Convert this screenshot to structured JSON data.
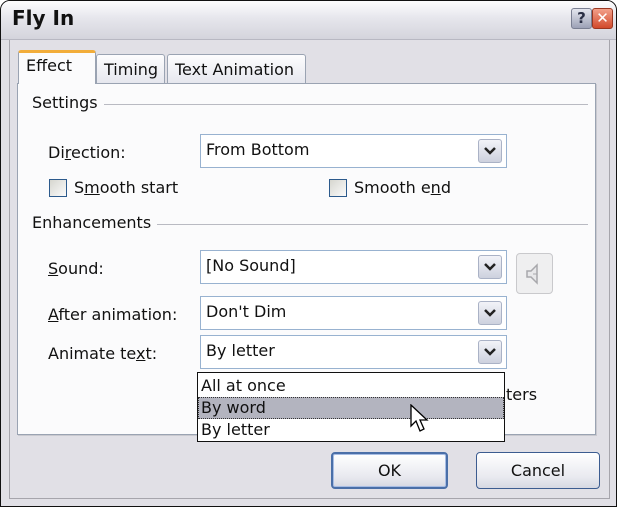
{
  "window": {
    "title": "Fly In",
    "help_icon": "help-icon",
    "close_icon": "close-icon",
    "help_glyph": "?",
    "close_glyph": "✕"
  },
  "tabs": [
    {
      "label": "Effect",
      "active": true
    },
    {
      "label": "Timing",
      "active": false
    },
    {
      "label": "Text Animation",
      "active": false
    }
  ],
  "settings": {
    "group_label": "Settings",
    "direction": {
      "label_pre": "Di",
      "label_u": "r",
      "label_post": "ection:",
      "value": "From Bottom"
    },
    "smooth_start": {
      "label_pre": "S",
      "label_u": "m",
      "label_post": "ooth start",
      "checked": false
    },
    "smooth_end": {
      "label_pre": "Smooth e",
      "label_u": "n",
      "label_post": "d",
      "checked": false
    }
  },
  "enhancements": {
    "group_label": "Enhancements",
    "sound": {
      "label_pre": "",
      "label_u": "S",
      "label_post": "ound:",
      "value": "[No Sound]"
    },
    "after_animation": {
      "label_pre": "",
      "label_u": "A",
      "label_post": "fter animation:",
      "value": "Don't Dim"
    },
    "animate_text": {
      "label_pre": "Animate te",
      "label_u": "x",
      "label_post": "t:",
      "value": "By letter"
    },
    "animate_text_options": [
      "All at once",
      "By word",
      "By letter"
    ],
    "highlighted_option": "By word",
    "partially_hidden_text": "ters"
  },
  "buttons": {
    "ok": "OK",
    "cancel": "Cancel"
  },
  "colors": {
    "active_tab_accent": "#f2ad3a",
    "highlight": "#b3b4bf",
    "close_button": "#d24a2c"
  }
}
